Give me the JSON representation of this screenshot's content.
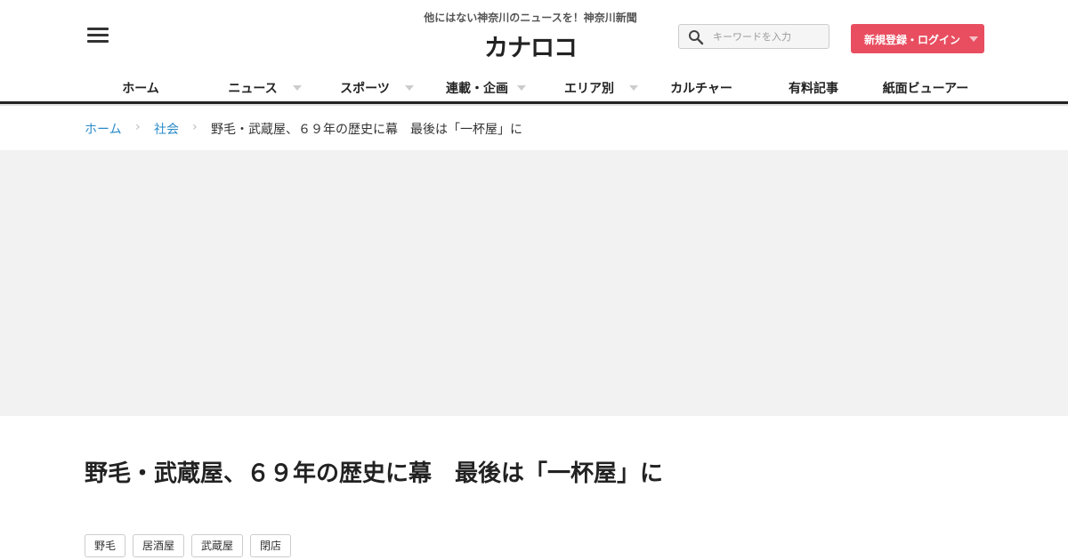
{
  "header": {
    "tagline": "他にはない神奈川のニュースを！神奈川新聞",
    "logo": "カナロコ",
    "search_placeholder": "キーワードを入力",
    "login_label": "新規登録・ログイン"
  },
  "nav": {
    "items": [
      {
        "label": "ホーム"
      },
      {
        "label": "ニュース"
      },
      {
        "label": "スポーツ"
      },
      {
        "label": "連載・企画"
      },
      {
        "label": "エリア別"
      },
      {
        "label": "カルチャー"
      },
      {
        "label": "有料記事"
      },
      {
        "label": "紙面ビューアー"
      }
    ]
  },
  "breadcrumb": {
    "home": "ホーム",
    "category": "社会",
    "current": "野毛・武蔵屋、６９年の歴史に幕　最後は「一杯屋」に"
  },
  "article": {
    "title": "野毛・武蔵屋、６９年の歴史に幕　最後は「一杯屋」に",
    "tags": [
      "野毛",
      "居酒屋",
      "武蔵屋",
      "閉店"
    ]
  },
  "colors": {
    "accent": "#e84e60",
    "link": "#2a8bc9"
  }
}
